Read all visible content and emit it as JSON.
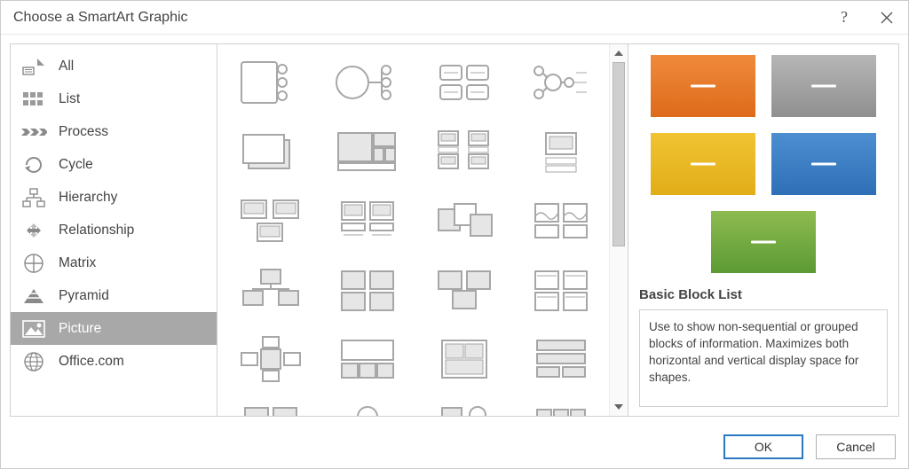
{
  "window": {
    "title": "Choose a SmartArt Graphic"
  },
  "categories": {
    "items": [
      {
        "id": "all",
        "label": "All",
        "icon": "all-icon"
      },
      {
        "id": "list",
        "label": "List",
        "icon": "list-icon"
      },
      {
        "id": "process",
        "label": "Process",
        "icon": "process-icon"
      },
      {
        "id": "cycle",
        "label": "Cycle",
        "icon": "cycle-icon"
      },
      {
        "id": "hierarchy",
        "label": "Hierarchy",
        "icon": "hierarchy-icon"
      },
      {
        "id": "relationship",
        "label": "Relationship",
        "icon": "relationship-icon"
      },
      {
        "id": "matrix",
        "label": "Matrix",
        "icon": "matrix-icon"
      },
      {
        "id": "pyramid",
        "label": "Pyramid",
        "icon": "pyramid-icon"
      },
      {
        "id": "picture",
        "label": "Picture",
        "icon": "picture-icon"
      },
      {
        "id": "office",
        "label": "Office.com",
        "icon": "globe-icon"
      }
    ],
    "selected_id": "picture"
  },
  "preview": {
    "title": "Basic Block List",
    "description": "Use to show non-sequential or grouped blocks of information. Maximizes both horizontal and vertical display space for shapes.",
    "blocks": [
      {
        "color": "orange"
      },
      {
        "color": "gray"
      },
      {
        "color": "yellow"
      },
      {
        "color": "blue"
      },
      {
        "color": "green"
      }
    ]
  },
  "buttons": {
    "ok": "OK",
    "cancel": "Cancel"
  }
}
